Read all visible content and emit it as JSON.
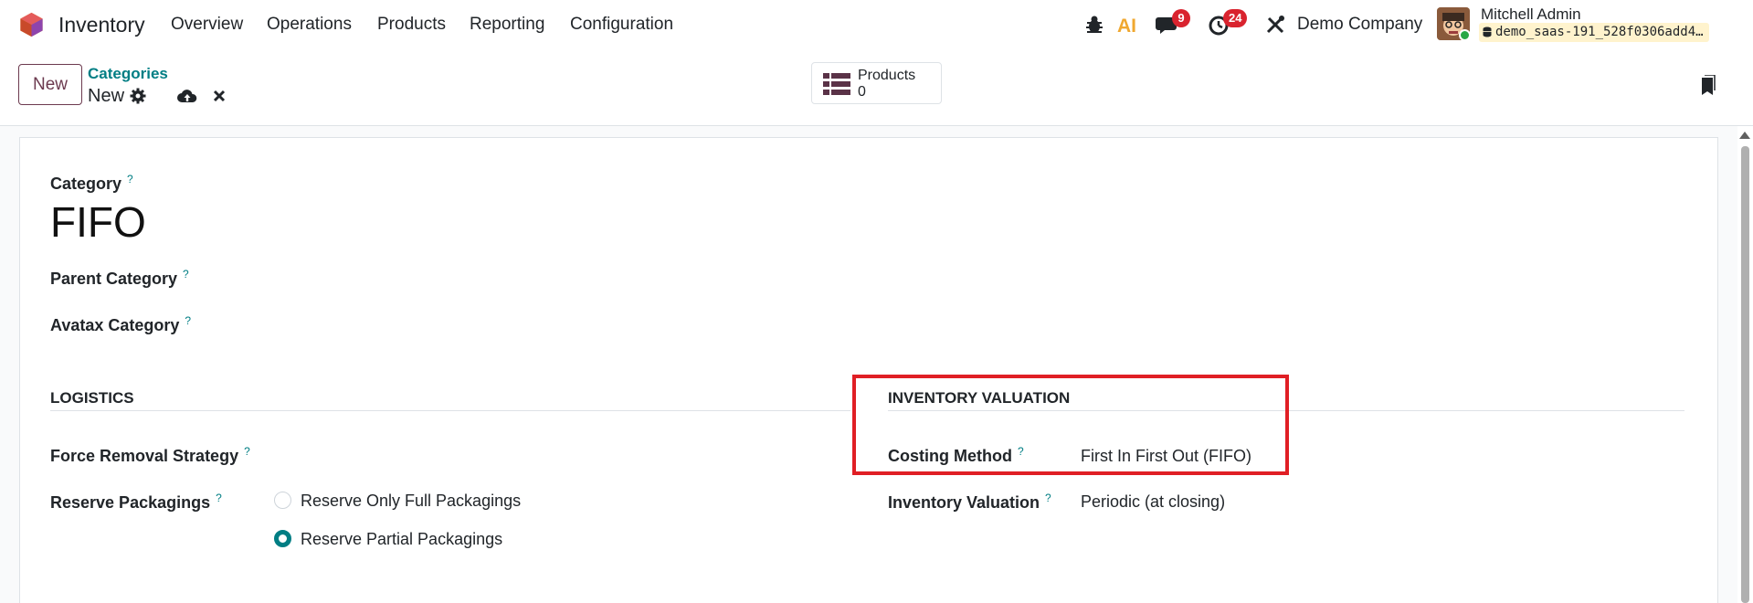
{
  "navbar": {
    "app_name": "Inventory",
    "menu": [
      "Overview",
      "Operations",
      "Products",
      "Reporting",
      "Configuration"
    ],
    "messages_count": "9",
    "activities_count": "24",
    "company": "Demo Company",
    "user_name": "Mitchell Admin",
    "database": "demo_saas-191_528f0306add4…",
    "ai_label": "AI"
  },
  "control_panel": {
    "new_label": "New",
    "breadcrumb_parent": "Categories",
    "record_title": "New",
    "smart_button": {
      "label": "Products",
      "value": "0"
    }
  },
  "form": {
    "category_label": "Category",
    "category_name": "FIFO",
    "parent_category_label": "Parent Category",
    "avatax_category_label": "Avatax Category",
    "help_mark": "?",
    "logistics": {
      "title": "LOGISTICS",
      "force_removal_label": "Force Removal Strategy",
      "reserve_packagings_label": "Reserve Packagings",
      "options": [
        "Reserve Only Full Packagings",
        "Reserve Partial Packagings"
      ],
      "selected_option": "Reserve Partial Packagings"
    },
    "valuation": {
      "title": "INVENTORY VALUATION",
      "costing_method_label": "Costing Method",
      "costing_method_value": "First In First Out (FIFO)",
      "inventory_valuation_label": "Inventory Valuation",
      "inventory_valuation_value": "Periodic (at closing)"
    }
  },
  "colors": {
    "brand": "#6c3a4f",
    "accent": "#017e84",
    "badge": "#d9232e",
    "highlight": "#e01f25"
  }
}
